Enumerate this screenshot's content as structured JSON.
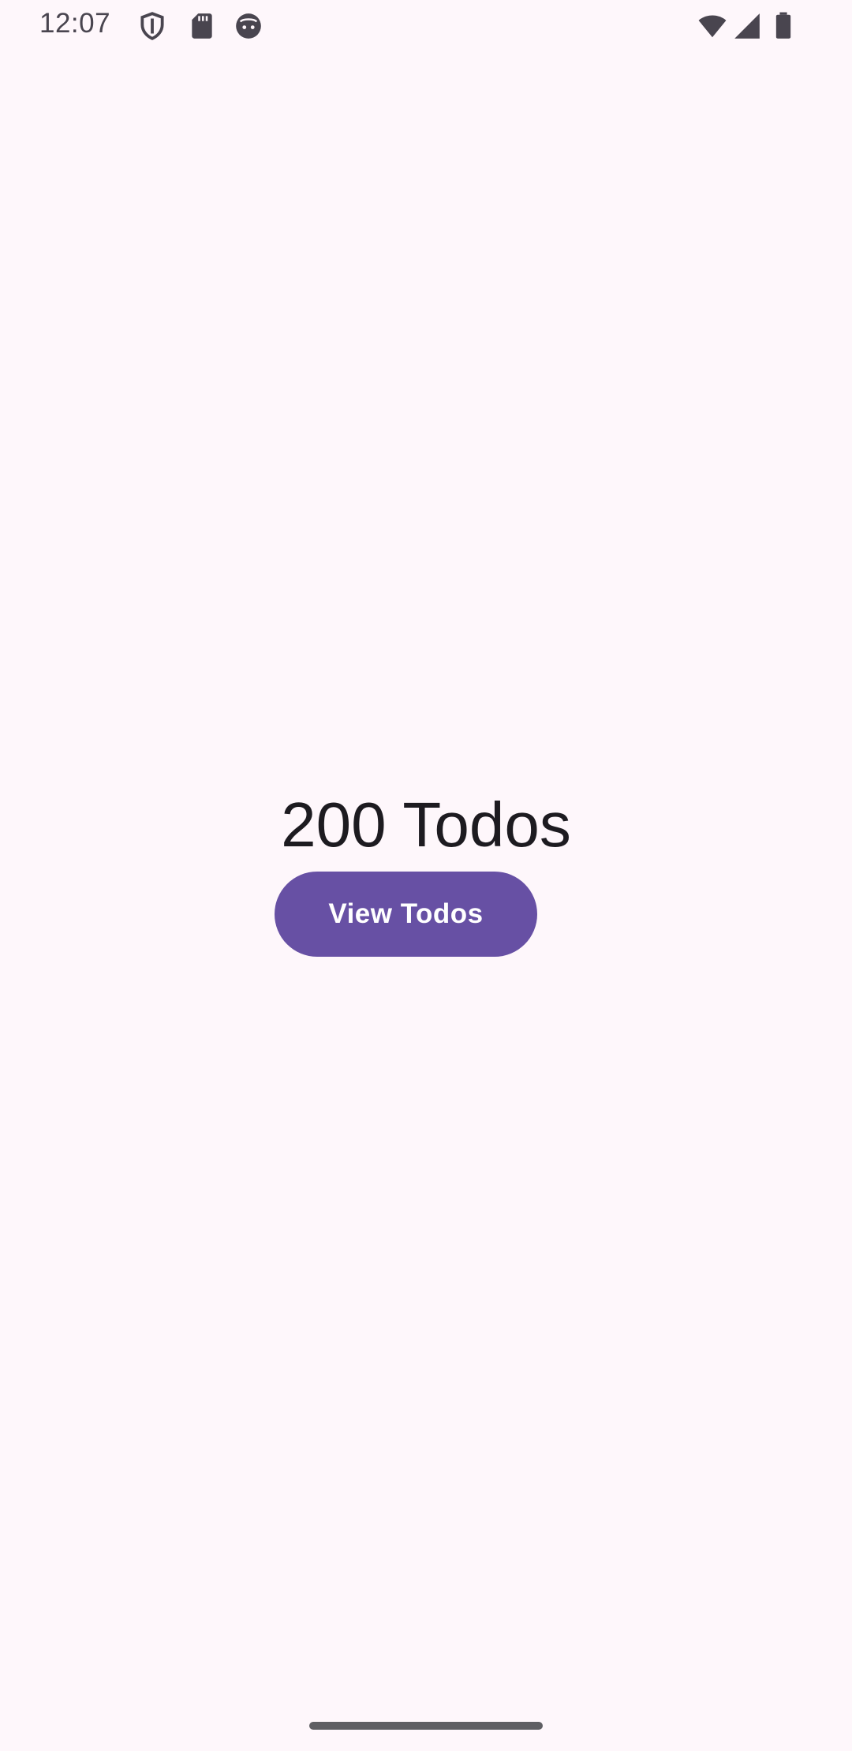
{
  "status_bar": {
    "time": "12:07",
    "left_icons": [
      "shield-icon",
      "sd-card-icon",
      "android-face-icon"
    ],
    "right_icons": [
      "wifi-icon",
      "cellular-signal-icon",
      "battery-icon"
    ]
  },
  "main": {
    "todo_count_text": "200 Todos",
    "view_button_label": "View Todos"
  },
  "colors": {
    "background": "#FEF7FB",
    "button_primary": "#6750A4",
    "button_text": "#FFFFFF",
    "text_primary": "#1D1B20",
    "status_icons": "#49454F"
  }
}
